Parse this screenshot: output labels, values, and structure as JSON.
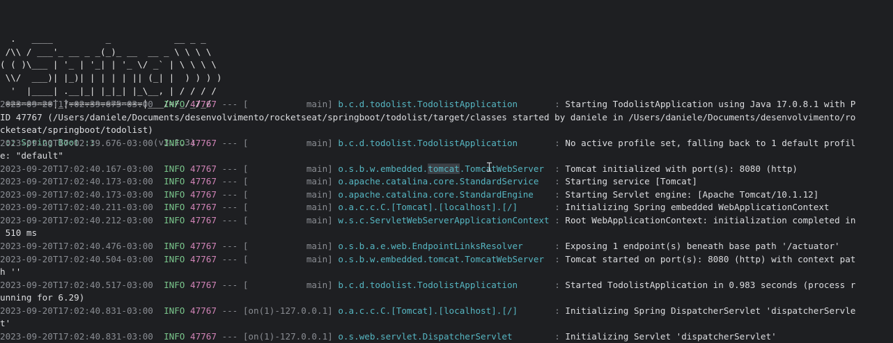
{
  "banner": {
    "art": [
      "  .   ____          _            __ _ _",
      " /\\\\ / ___'_ __ _ _(_)_ __  __ _ \\ \\ \\ \\",
      "( ( )\\___ | '_ | '_| | '_ \\/ _` | \\ \\ \\ \\",
      " \\\\/  ___)| |_)| | | | | || (_| |  ) ) ) )",
      "  '  |____| .__|_| |_|_| |_\\__, | / / / /",
      " =========|_|==============|___/=/_/_/_/"
    ],
    "spring_label": " :: Spring Boot :: ",
    "spring_version": "(v3.1.3)"
  },
  "log": {
    "lines": [
      {
        "ts": "2023-09-20T17:02:39.675-03:00",
        "level": "INFO",
        "pid": "47767",
        "thread": "           main",
        "logger": "b.c.d.todolist.TodolistApplication",
        "msg": "Starting TodolistApplication using Java 17.0.8.1 with P",
        "cont": [
          "ID 47767 (/Users/daniele/Documents/desenvolvimento/rocketseat/springboot/todolist/target/classes started by daniele in /Users/daniele/Documents/desenvolvimento/ro",
          "cketseat/springboot/todolist)"
        ]
      },
      {
        "ts": "2023-09-20T17:02:39.676-03:00",
        "level": "INFO",
        "pid": "47767",
        "thread": "           main",
        "logger": "b.c.d.todolist.TodolistApplication",
        "msg": "No active profile set, falling back to 1 default profil",
        "cont": [
          "e: \"default\""
        ]
      },
      {
        "ts": "2023-09-20T17:02:40.167-03:00",
        "level": "INFO",
        "pid": "47767",
        "thread": "           main",
        "logger_pre": "o.s.b.w.embedded.",
        "logger_hl": "tomcat",
        "logger_post": ".TomcatWebServer",
        "msg": "Tomcat initialized with port(s): 8080 (http)",
        "cont": []
      },
      {
        "ts": "2023-09-20T17:02:40.173-03:00",
        "level": "INFO",
        "pid": "47767",
        "thread": "           main",
        "logger": "o.apache.catalina.core.StandardService",
        "msg": "Starting service [Tomcat]",
        "cont": []
      },
      {
        "ts": "2023-09-20T17:02:40.173-03:00",
        "level": "INFO",
        "pid": "47767",
        "thread": "           main",
        "logger": "o.apache.catalina.core.StandardEngine",
        "msg": "Starting Servlet engine: [Apache Tomcat/10.1.12]",
        "cont": []
      },
      {
        "ts": "2023-09-20T17:02:40.211-03:00",
        "level": "INFO",
        "pid": "47767",
        "thread": "           main",
        "logger": "o.a.c.c.C.[Tomcat].[localhost].[/]",
        "msg": "Initializing Spring embedded WebApplicationContext",
        "cont": []
      },
      {
        "ts": "2023-09-20T17:02:40.212-03:00",
        "level": "INFO",
        "pid": "47767",
        "thread": "           main",
        "logger": "w.s.c.ServletWebServerApplicationContext",
        "msg": "Root WebApplicationContext: initialization completed in",
        "cont": [
          " 510 ms"
        ]
      },
      {
        "ts": "2023-09-20T17:02:40.476-03:00",
        "level": "INFO",
        "pid": "47767",
        "thread": "           main",
        "logger": "o.s.b.a.e.web.EndpointLinksResolver",
        "msg": "Exposing 1 endpoint(s) beneath base path '/actuator'",
        "cont": []
      },
      {
        "ts": "2023-09-20T17:02:40.504-03:00",
        "level": "INFO",
        "pid": "47767",
        "thread": "           main",
        "logger": "o.s.b.w.embedded.tomcat.TomcatWebServer",
        "msg": "Tomcat started on port(s): 8080 (http) with context pat",
        "cont": [
          "h ''"
        ]
      },
      {
        "ts": "2023-09-20T17:02:40.517-03:00",
        "level": "INFO",
        "pid": "47767",
        "thread": "           main",
        "logger": "b.c.d.todolist.TodolistApplication",
        "msg": "Started TodolistApplication in 0.983 seconds (process r",
        "cont": [
          "unning for 6.29)"
        ]
      },
      {
        "ts": "2023-09-20T17:02:40.831-03:00",
        "level": "INFO",
        "pid": "47767",
        "thread": "on(1)-127.0.0.1",
        "logger": "o.a.c.c.C.[Tomcat].[localhost].[/]",
        "msg": "Initializing Spring DispatcherServlet 'dispatcherServle",
        "cont": [
          "t'"
        ]
      },
      {
        "ts": "2023-09-20T17:02:40.831-03:00",
        "level": "INFO",
        "pid": "47767",
        "thread": "on(1)-127.0.0.1",
        "logger": "o.s.web.servlet.DispatcherServlet",
        "msg": "Initializing Servlet 'dispatcherServlet'",
        "cont": []
      }
    ]
  }
}
